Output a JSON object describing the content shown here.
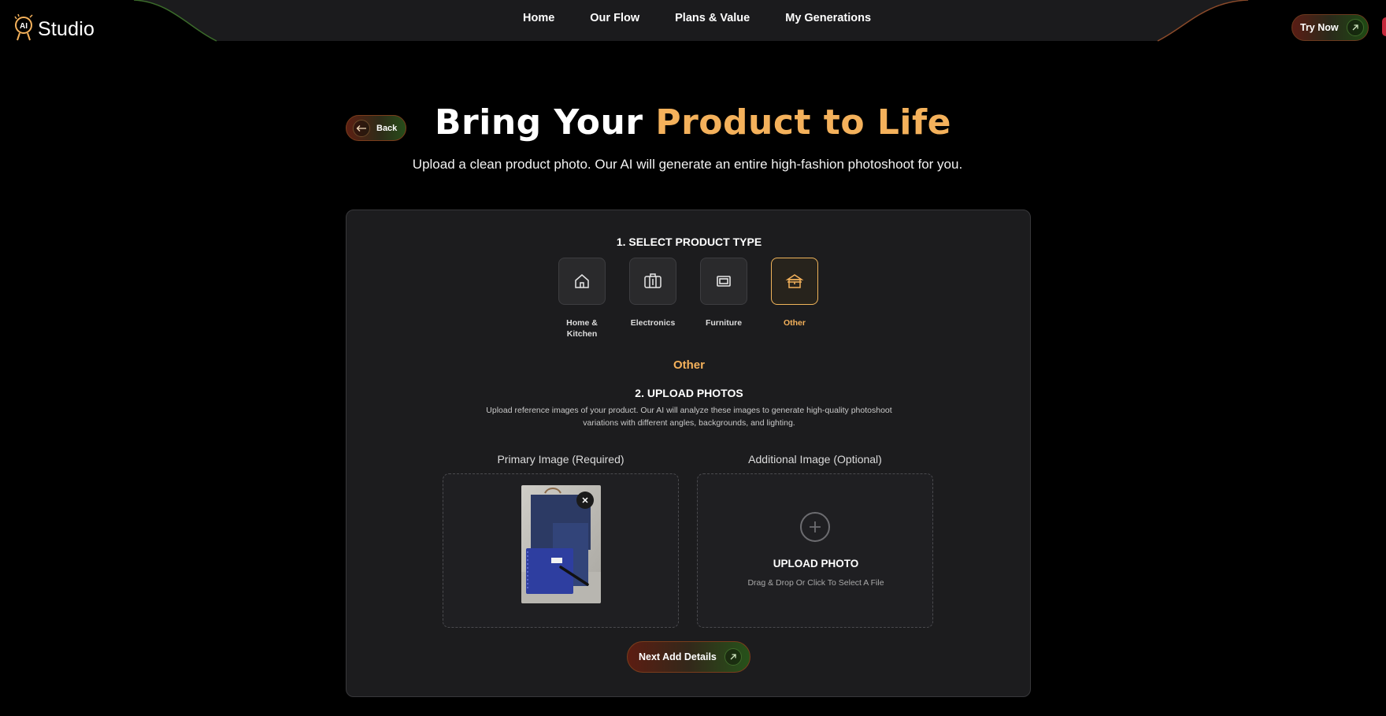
{
  "header": {
    "logo_badge": "AI",
    "logo_text": "Studio",
    "nav": [
      "Home",
      "Our Flow",
      "Plans & Value",
      "My Generations"
    ],
    "cta_label": "Try Now",
    "cta_icon": "arrow-up-right-icon"
  },
  "hero": {
    "back_label": "Back",
    "back_icon": "arrow-left-icon",
    "title_plain": "Bring Your ",
    "title_accent": "Product to Life",
    "subtitle": "Upload a clean product photo. Our AI will generate an entire high-fashion photoshoot for you."
  },
  "form": {
    "step1_title": "1. SELECT PRODUCT TYPE",
    "product_types": [
      {
        "label": "Home & Kitchen",
        "icon": "home-icon",
        "selected": false
      },
      {
        "label": "Electronics",
        "icon": "electronics-icon",
        "selected": false
      },
      {
        "label": "Furniture",
        "icon": "furniture-icon",
        "selected": false
      },
      {
        "label": "Other",
        "icon": "box-icon",
        "selected": true
      }
    ],
    "selected_type": "Other",
    "step2_title": "2. UPLOAD PHOTOS",
    "upload_description": "Upload reference images of your product. Our AI will analyze these images to generate high-quality photoshoot variations with different angles, backgrounds, and lighting.",
    "primary_label": "Primary Image (Required)",
    "additional_label": "Additional Image (Optional)",
    "upload_title": "UPLOAD PHOTO",
    "upload_hint": "Drag & Drop Or Click To Select A File",
    "next_label": "Next Add Details"
  },
  "colors": {
    "accent": "#f4b15b",
    "background": "#000000",
    "card": "#1c1c1e",
    "nav_bar": "#1b1b1d"
  }
}
